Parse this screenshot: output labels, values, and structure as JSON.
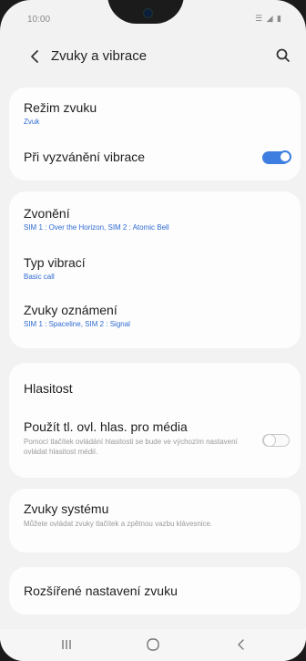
{
  "status": {
    "time": "10:00",
    "icons": "☰ ◢ ▮"
  },
  "app_bar": {
    "title": "Zvuky a vibrace"
  },
  "sections": {
    "mode": {
      "title": "Režim zvuku",
      "value": "Zvuk"
    },
    "vibrate_ring": {
      "title": "Při vyzvánění vibrace",
      "enabled": true
    },
    "ringtone": {
      "title": "Zvonění",
      "value": "SIM 1 : Over the Horizon, SIM 2 : Atomic Bell"
    },
    "vibration_type": {
      "title": "Typ vibrací",
      "value": "Basic call"
    },
    "notification_sounds": {
      "title": "Zvuky oznámení",
      "value": "SIM 1 : Spaceline, SIM 2 : Signal"
    },
    "volume": {
      "title": "Hlasitost"
    },
    "media_keys": {
      "title": "Použít tl. ovl. hlas. pro média",
      "desc": "Pomocí tlačítek ovládání hlasitosti se bude ve výchozím nastavení ovládat hlasitost médií.",
      "enabled": false
    },
    "system_sounds": {
      "title": "Zvuky systému",
      "desc": "Můžete ovládat zvuky tlačítek a zpětnou vazbu klávesnice."
    },
    "advanced": {
      "title": "Rozšířené nastavení zvuku"
    }
  },
  "icons": {
    "back": "chevron-left-icon",
    "search": "search-icon",
    "recents": "recents-icon",
    "home": "home-icon",
    "nav_back": "nav-back-icon"
  },
  "colors": {
    "accent": "#3d7ee0",
    "subtitle": "#2f6bd3",
    "background": "#f2f2f2",
    "card": "#fdfdfd"
  }
}
